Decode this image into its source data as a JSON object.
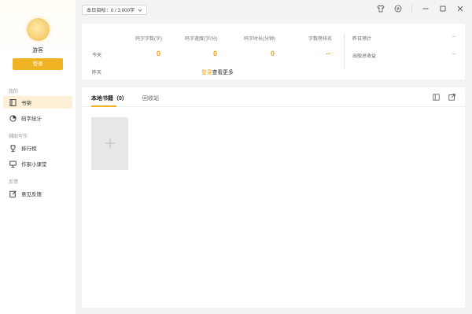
{
  "sidebar": {
    "username": "游客",
    "login_label": "登录",
    "sections": [
      {
        "label": "我的",
        "items": [
          {
            "label": "书架",
            "icon": "book-icon",
            "active": true
          },
          {
            "label": "码字统计",
            "icon": "chart-icon",
            "active": false
          }
        ]
      },
      {
        "label": "辅助写作",
        "items": [
          {
            "label": "排行榜",
            "icon": "trophy-icon",
            "active": false
          },
          {
            "label": "作家小课堂",
            "icon": "classroom-icon",
            "active": false
          }
        ]
      },
      {
        "label": "反馈",
        "items": [
          {
            "label": "意见反馈",
            "icon": "feedback-icon",
            "active": false
          }
        ]
      }
    ]
  },
  "topbar": {
    "goal_label": "本日目标：0 / 3,000字",
    "icons": [
      "shirt-icon",
      "add-circle-icon",
      "minimize-icon",
      "maximize-icon",
      "close-icon"
    ]
  },
  "stats": {
    "headers": [
      "码字字数(字)",
      "码字速度(字/分)",
      "码字时长(分钟)",
      "字数榜排名"
    ],
    "today_label": "今天",
    "yesterday_label": "昨天",
    "today_values": [
      "0",
      "0",
      "0",
      "--"
    ],
    "login_link": "登录",
    "login_suffix": "查看更多",
    "right": [
      {
        "label": "昨日预计",
        "value": "--"
      },
      {
        "label": "出版总收益",
        "value": "--"
      }
    ]
  },
  "shelf": {
    "tab_local": "本地书籍（0）",
    "tab_recycle": "回收站",
    "icons": [
      "sort-icon",
      "import-icon"
    ]
  },
  "colors": {
    "accent": "#f0b323",
    "value": "#f0a31c",
    "active_bg": "#fcf1d6"
  }
}
